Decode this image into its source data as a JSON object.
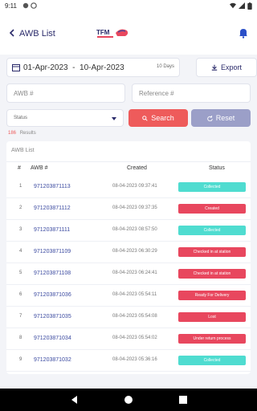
{
  "status_bar": {
    "time": "9:11"
  },
  "app_bar": {
    "title": "AWB List",
    "logo_text": "TFM"
  },
  "filters": {
    "date_range": "01-Apr-2023  -  10-Apr-2023",
    "days": "10 Days",
    "export_label": "Export",
    "awb_placeholder": "AWB #",
    "reference_placeholder": "Reference #",
    "status_placeholder": "Status",
    "search_label": "Search",
    "reset_label": "Reset"
  },
  "results": {
    "count": "186",
    "label": "Results"
  },
  "table": {
    "title": "AWB List",
    "headers": {
      "num": "#",
      "awb": "AWB #",
      "created": "Created",
      "status": "Status"
    },
    "rows": [
      {
        "num": "1",
        "awb": "971203871113",
        "created": "08-04-2023 09:37:41",
        "status": "Collected"
      },
      {
        "num": "2",
        "awb": "971203871112",
        "created": "08-04-2023 09:37:35",
        "status": "Created"
      },
      {
        "num": "3",
        "awb": "971203871111",
        "created": "08-04-2023 08:57:50",
        "status": "Collected"
      },
      {
        "num": "4",
        "awb": "971203871109",
        "created": "08-04-2023 06:30:29",
        "status": "Checked in at station"
      },
      {
        "num": "5",
        "awb": "971203871108",
        "created": "08-04-2023 06:24:41",
        "status": "Checked in at station"
      },
      {
        "num": "6",
        "awb": "971203871036",
        "created": "08-04-2023 05:54:11",
        "status": "Ready For Delivery"
      },
      {
        "num": "7",
        "awb": "971203871035",
        "created": "08-04-2023 05:54:08",
        "status": "Lost"
      },
      {
        "num": "8",
        "awb": "971203871034",
        "created": "08-04-2023 05:54:02",
        "status": "Under return process"
      },
      {
        "num": "9",
        "awb": "971203871032",
        "created": "08-04-2023 05:36:16",
        "status": "Collected"
      }
    ]
  },
  "status_colors": {
    "Collected": "#4fdcd0",
    "Created": "#e8475e",
    "Checked in at station": "#e8475e",
    "Ready For Delivery": "#e8475e",
    "Lost": "#e8475e",
    "Under return process": "#e8475e"
  },
  "colors": {
    "accent": "#ee5b5b",
    "secondary": "#9b9fc8",
    "brand": "#2a2a6a"
  }
}
